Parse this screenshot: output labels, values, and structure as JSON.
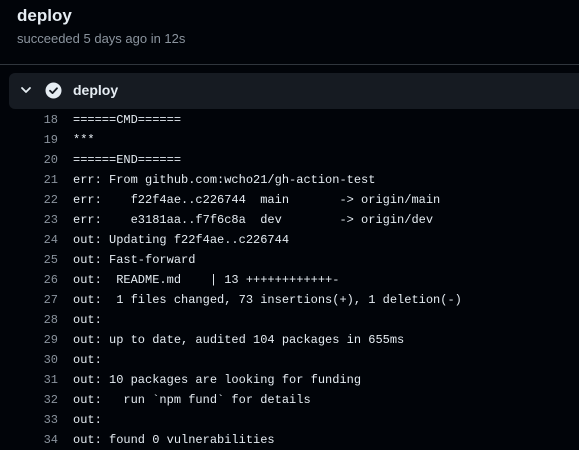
{
  "header": {
    "title": "deploy",
    "subtitle": "succeeded 5 days ago in 12s"
  },
  "step": {
    "name": "deploy",
    "status": "success"
  },
  "log": [
    {
      "num": "18",
      "text": "======CMD======"
    },
    {
      "num": "19",
      "text": "***"
    },
    {
      "num": "20",
      "text": "======END======"
    },
    {
      "num": "21",
      "text": "err: From github.com:wcho21/gh-action-test"
    },
    {
      "num": "22",
      "text": "err:    f22f4ae..c226744  main       -> origin/main"
    },
    {
      "num": "23",
      "text": "err:    e3181aa..f7f6c8a  dev        -> origin/dev"
    },
    {
      "num": "24",
      "text": "out: Updating f22f4ae..c226744"
    },
    {
      "num": "25",
      "text": "out: Fast-forward"
    },
    {
      "num": "26",
      "text": "out:  README.md    | 13 ++++++++++++-"
    },
    {
      "num": "27",
      "text": "out:  1 files changed, 73 insertions(+), 1 deletion(-)"
    },
    {
      "num": "28",
      "text": "out:"
    },
    {
      "num": "29",
      "text": "out: up to date, audited 104 packages in 655ms"
    },
    {
      "num": "30",
      "text": "out:"
    },
    {
      "num": "31",
      "text": "out: 10 packages are looking for funding"
    },
    {
      "num": "32",
      "text": "out:   run `npm fund` for details"
    },
    {
      "num": "33",
      "text": "out:"
    },
    {
      "num": "34",
      "text": "out: found 0 vulnerabilities"
    }
  ]
}
